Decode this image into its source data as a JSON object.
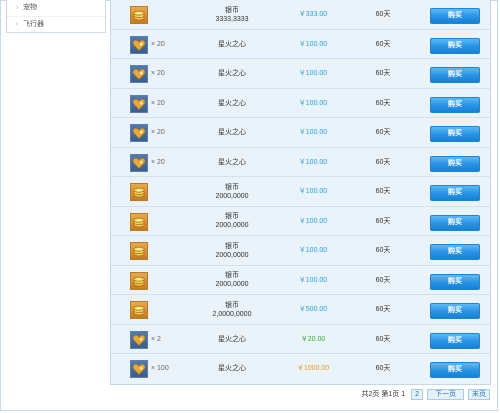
{
  "sidebar": {
    "items": [
      {
        "label": "宠物"
      },
      {
        "label": "飞行器"
      }
    ]
  },
  "colors": {
    "price_blue": "#2aa3d8",
    "price_green": "#3aaa35",
    "price_orange": "#e8981e",
    "buy_button": "#2a95e6"
  },
  "rows": [
    {
      "icon": "coin-bundle-icon",
      "qty": "",
      "name": "银币",
      "amount": "3333,3333",
      "price": "￥333.00",
      "price_color": "blue",
      "duration": "60天",
      "buy_label": "购买"
    },
    {
      "icon": "star-heart-icon",
      "qty": "× 20",
      "name": "星火之心",
      "amount": "",
      "price": "￥100.00",
      "price_color": "blue",
      "duration": "60天",
      "buy_label": "购买"
    },
    {
      "icon": "star-heart-icon",
      "qty": "× 20",
      "name": "星火之心",
      "amount": "",
      "price": "￥100.00",
      "price_color": "blue",
      "duration": "60天",
      "buy_label": "购买"
    },
    {
      "icon": "star-heart-icon",
      "qty": "× 20",
      "name": "星火之心",
      "amount": "",
      "price": "￥100.00",
      "price_color": "blue",
      "duration": "60天",
      "buy_label": "购买"
    },
    {
      "icon": "star-heart-icon",
      "qty": "× 20",
      "name": "星火之心",
      "amount": "",
      "price": "￥100.00",
      "price_color": "blue",
      "duration": "60天",
      "buy_label": "购买"
    },
    {
      "icon": "star-heart-icon",
      "qty": "× 20",
      "name": "星火之心",
      "amount": "",
      "price": "￥100.00",
      "price_color": "blue",
      "duration": "60天",
      "buy_label": "购买"
    },
    {
      "icon": "coin-bundle-icon",
      "qty": "",
      "name": "银币",
      "amount": "2000,0000",
      "price": "￥100.00",
      "price_color": "blue",
      "duration": "60天",
      "buy_label": "购买"
    },
    {
      "icon": "coin-bundle-icon",
      "qty": "",
      "name": "银币",
      "amount": "2000,0000",
      "price": "￥100.00",
      "price_color": "blue",
      "duration": "60天",
      "buy_label": "购买"
    },
    {
      "icon": "coin-bundle-icon",
      "qty": "",
      "name": "银币",
      "amount": "2000,0000",
      "price": "￥100.00",
      "price_color": "blue",
      "duration": "60天",
      "buy_label": "购买"
    },
    {
      "icon": "coin-bundle-icon",
      "qty": "",
      "name": "银币",
      "amount": "2000,0000",
      "price": "￥100.00",
      "price_color": "blue",
      "duration": "60天",
      "buy_label": "购买"
    },
    {
      "icon": "coin-bundle-icon",
      "qty": "",
      "name": "银币",
      "amount": "2,0000,0000",
      "price": "￥500.00",
      "price_color": "blue",
      "duration": "60天",
      "buy_label": "购买"
    },
    {
      "icon": "star-heart-icon",
      "qty": "× 2",
      "name": "星火之心",
      "amount": "",
      "price": "￥20.00",
      "price_color": "green",
      "duration": "60天",
      "buy_label": "购买"
    },
    {
      "icon": "star-heart-icon",
      "qty": "× 100",
      "name": "星火之心",
      "amount": "",
      "price": "￥1000.00",
      "price_color": "orange",
      "duration": "60天",
      "buy_label": "购买"
    }
  ],
  "pagination": {
    "summary": "共2页 第1页 1",
    "page_link": "2",
    "next_label": "下一页",
    "last_label": "末页"
  }
}
